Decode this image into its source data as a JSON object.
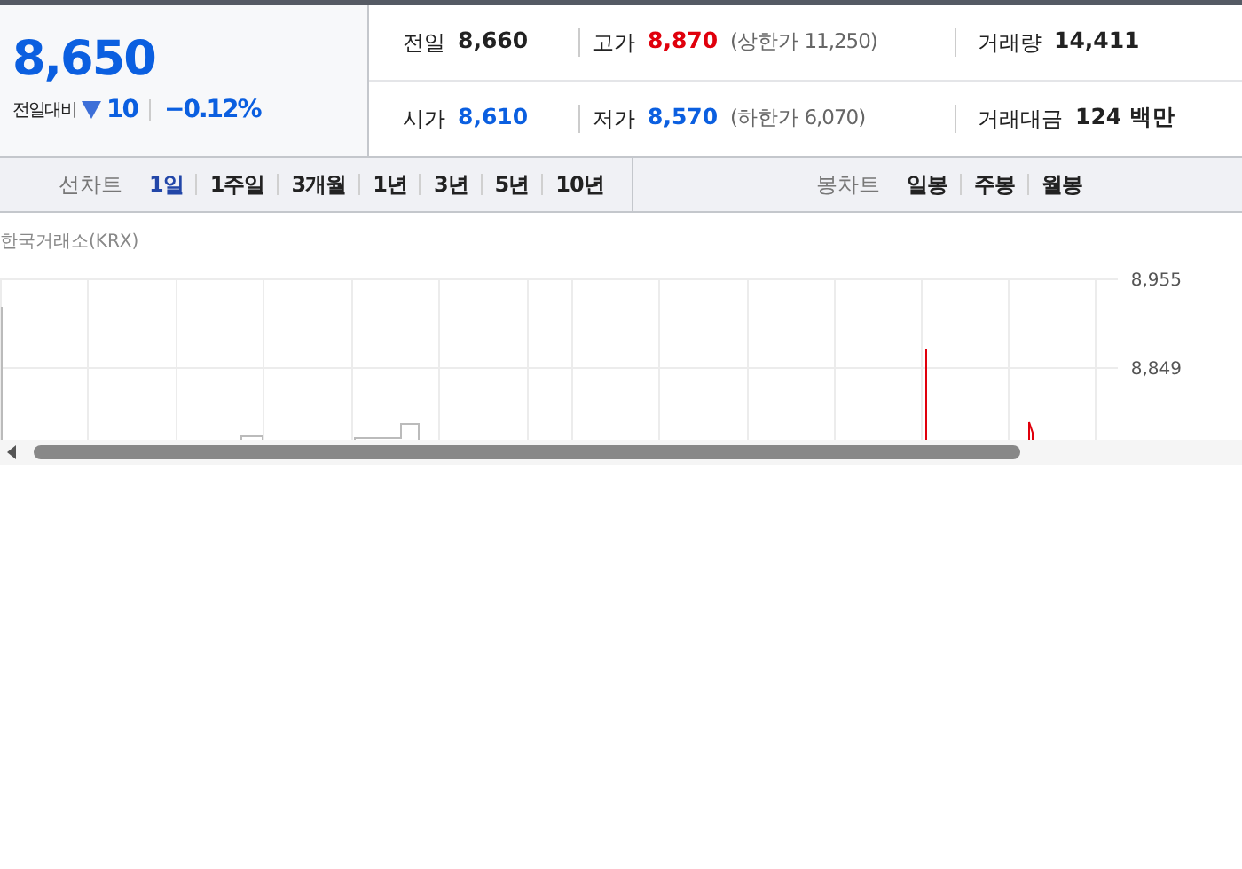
{
  "quote": {
    "price": "8,650",
    "change_label": "전일대비",
    "kind": "down",
    "change": "10",
    "change_rate": "−0.12%"
  },
  "stats": [
    {
      "label": "전일",
      "value": "8,660",
      "color": "#222222"
    },
    {
      "label": "고가",
      "value": "8,870",
      "color": "#e0000c",
      "limit": "(상한가 11,250)"
    },
    {
      "label": "거래량",
      "value": "14,411",
      "color": "#222222"
    },
    {
      "label": "시가",
      "value": "8,610",
      "color": "#0b5fe0"
    },
    {
      "label": "저가",
      "value": "8,570",
      "color": "#0b5fe0",
      "limit": "(하한가 6,070)"
    },
    {
      "label": "거래대금",
      "value": "124 백만",
      "color": "#222222"
    }
  ],
  "line_chart": {
    "label": "선차트",
    "periods": [
      {
        "label": "1일",
        "selected": true
      },
      {
        "label": "1주일",
        "selected": false
      },
      {
        "label": "3개월",
        "selected": false
      },
      {
        "label": "1년",
        "selected": false
      },
      {
        "label": "3년",
        "selected": false
      },
      {
        "label": "5년",
        "selected": false
      },
      {
        "label": "10년",
        "selected": false
      }
    ]
  },
  "candle_chart": {
    "label": "봉차트",
    "periods": [
      {
        "label": "일봉",
        "selected": false
      },
      {
        "label": "주봉",
        "selected": false
      },
      {
        "label": "월봉",
        "selected": false
      }
    ]
  },
  "chart": {
    "source": "한국거래소(KRX)",
    "y_labels": [
      "8,955",
      "8,849"
    ]
  }
}
